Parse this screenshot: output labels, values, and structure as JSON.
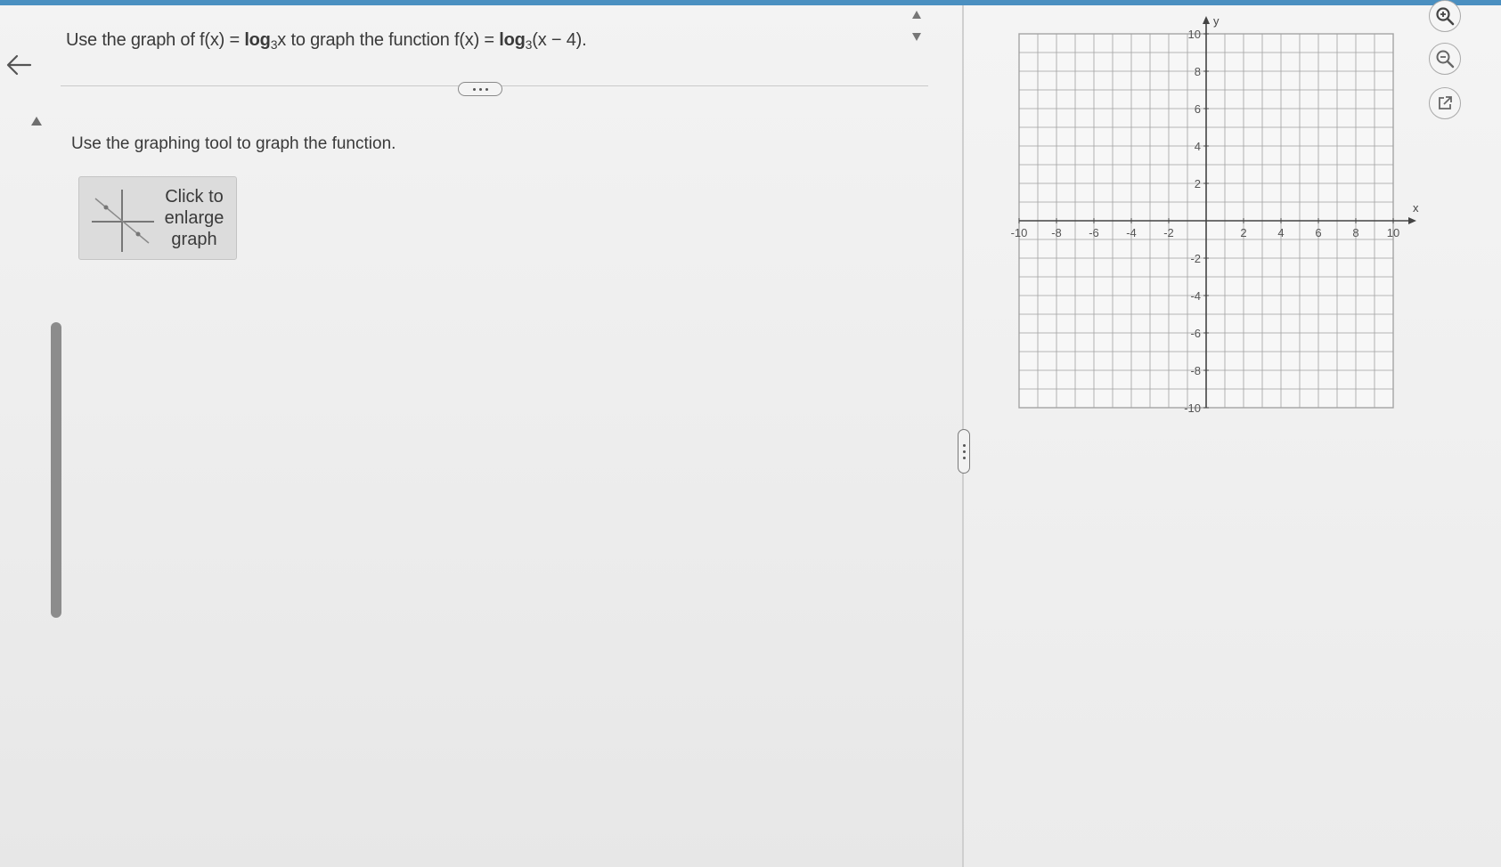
{
  "question": {
    "lead": "Use the graph of f(x) = ",
    "log1": "log",
    "base1": "3",
    "arg1": "x",
    "middle": " to graph the function f(x) = ",
    "log2": "log",
    "base2": "3",
    "arg2": "(x − 4)."
  },
  "instruction": "Use the graphing tool to graph the function.",
  "enlarge_button": {
    "label": "Click to\nenlarge\ngraph"
  },
  "graph": {
    "x_axis_label": "x",
    "y_axis_label": "y",
    "x_range": [
      -10,
      10
    ],
    "y_range": [
      -10,
      10
    ],
    "x_tick_labels": [
      "-10",
      "-8",
      "-6",
      "-4",
      "-2",
      "2",
      "4",
      "6",
      "8",
      "10"
    ],
    "y_tick_labels": [
      "10",
      "8",
      "6",
      "4",
      "2",
      "-2",
      "-4",
      "-6",
      "-8",
      "-10"
    ],
    "grid": true
  },
  "icons": {
    "back": "arrow-left-icon",
    "scroll_up": "triangle-up-icon",
    "stepper_up": "triangle-up-icon",
    "stepper_down": "triangle-down-icon",
    "more": "ellipsis-icon",
    "zoom_in": "zoom-in-icon",
    "zoom_out": "zoom-out-icon",
    "popout": "external-link-icon"
  },
  "colors": {
    "accent_bar": "#4a8fc0",
    "grid_line": "#a0a0a0",
    "axis": "#444444"
  }
}
